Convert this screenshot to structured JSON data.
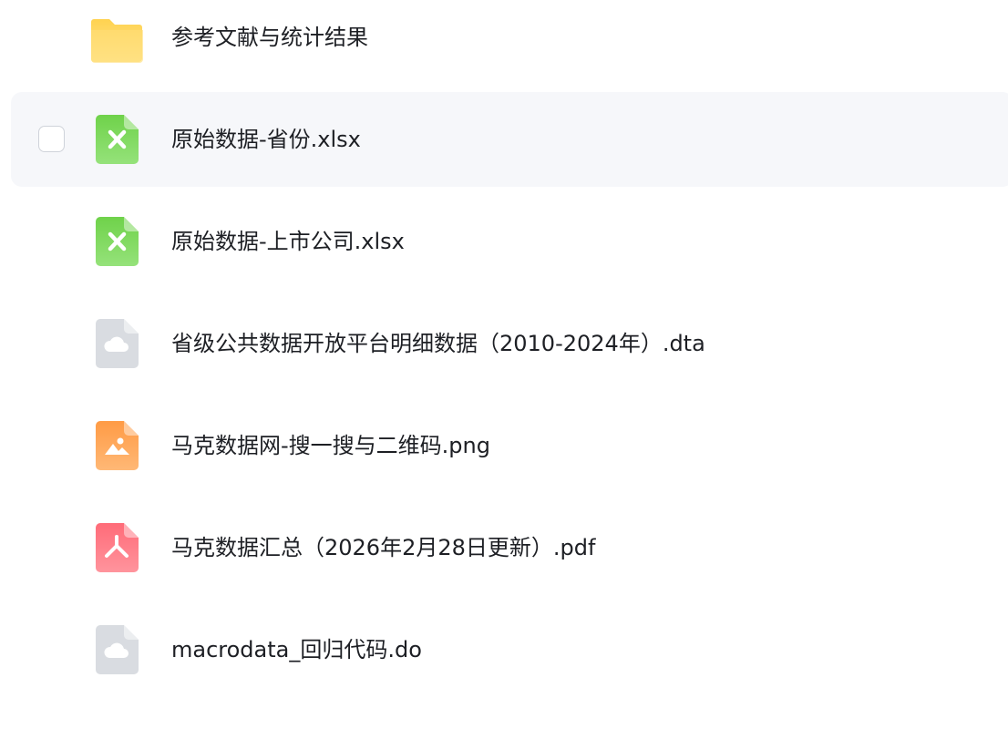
{
  "files": [
    {
      "name": "参考文献与统计结果",
      "type": "folder",
      "icon": "folder-icon"
    },
    {
      "name": "原始数据-省份.xlsx",
      "type": "excel",
      "icon": "excel-file-icon",
      "hovered": true
    },
    {
      "name": "原始数据-上市公司.xlsx",
      "type": "excel",
      "icon": "excel-file-icon"
    },
    {
      "name": "省级公共数据开放平台明细数据（2010-2024年）.dta",
      "type": "generic",
      "icon": "cloud-file-icon"
    },
    {
      "name": "马克数据网-搜一搜与二维码.png",
      "type": "image",
      "icon": "image-file-icon"
    },
    {
      "name": "马克数据汇总（2026年2月28日更新）.pdf",
      "type": "pdf",
      "icon": "pdf-file-icon"
    },
    {
      "name": "macrodata_回归代码.do",
      "type": "generic",
      "icon": "cloud-file-icon"
    }
  ],
  "colors": {
    "folder": "#ffd45c",
    "excel": "#7ed957",
    "generic": "#d9dce1",
    "image": "#ffa858",
    "pdf": "#ff7b85",
    "hover_background": "#f6f7fa",
    "text": "#1d1f24"
  }
}
